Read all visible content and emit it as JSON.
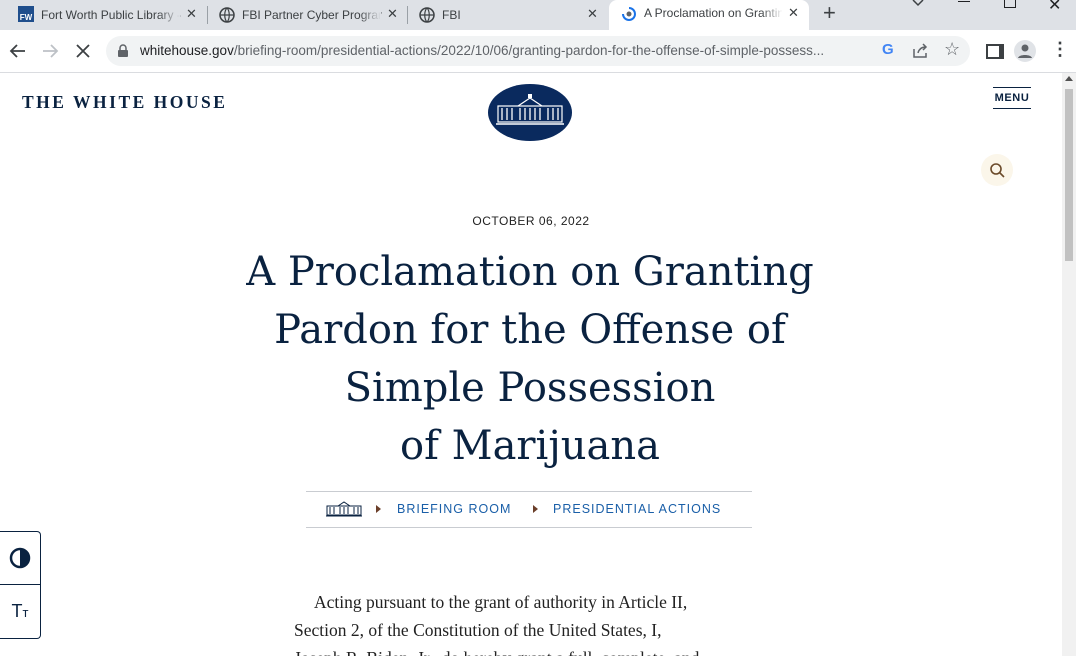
{
  "browser": {
    "tabs": [
      {
        "title": "Fort Worth Public Library -",
        "favicon": "fort-worth-library-favicon"
      },
      {
        "title": "FBI Partner Cyber Program",
        "favicon": "globe-icon"
      },
      {
        "title": "FBI",
        "favicon": "globe-icon"
      },
      {
        "title": "A Proclamation on Granting",
        "favicon": "loading-spinner-icon",
        "active": true
      }
    ],
    "new_tab": "+",
    "url_host": "whitehouse.gov",
    "url_path": "/briefing-room/presidential-actions/2022/10/06/granting-pardon-for-the-offense-of-simple-possess..."
  },
  "site": {
    "name": "THE WHITE HOUSE",
    "menu_label": "MENU"
  },
  "article": {
    "date": "OCTOBER 06, 2022",
    "title_lines": [
      "A Proclamation on Granting",
      "Pardon for the Offense of",
      "Simple Possession",
      "of Marijuana"
    ],
    "breadcrumbs": [
      "BRIEFING ROOM",
      "PRESIDENTIAL ACTIONS"
    ],
    "body_lines": [
      "Acting pursuant to the grant of authority in Article II,",
      "Section 2, of the Constitution of the United States, I,",
      "Joseph R. Biden, Jr., do hereby grant a full, complete, and"
    ]
  },
  "colors": {
    "navy": "#0a2240",
    "link": "#1a5fa8",
    "chrome": "#dee1e6"
  }
}
